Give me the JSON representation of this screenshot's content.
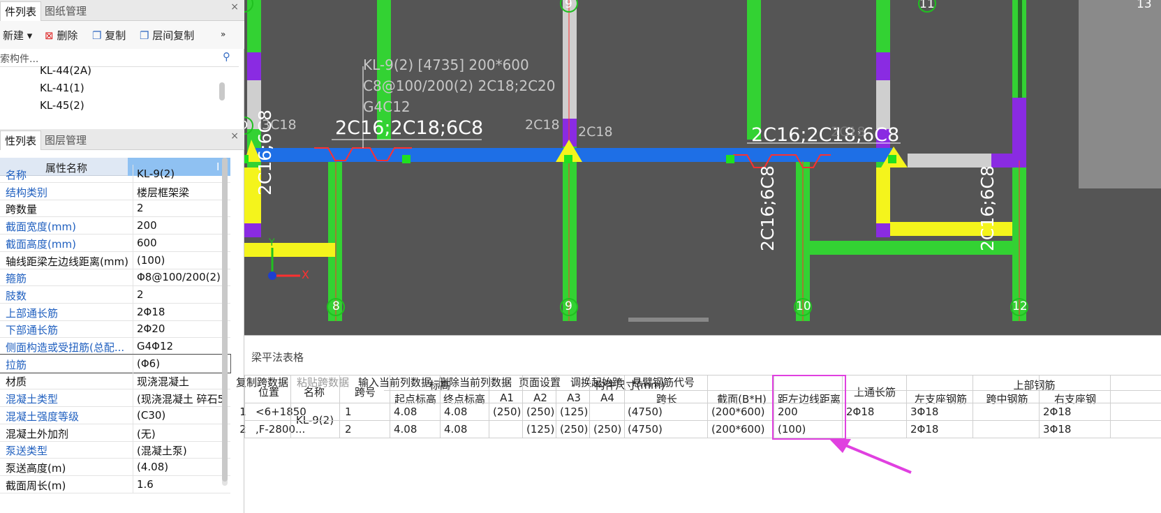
{
  "component_list": {
    "tabs": [
      "件列表",
      "图纸管理"
    ],
    "toolbar": {
      "new": "新建",
      "delete": "删除",
      "copy": "复制",
      "floor_copy": "层间复制",
      "more": "»"
    },
    "search_placeholder": "索构件...",
    "items": [
      "KL-44(2A)",
      "KL-41(1)",
      "KL-45(2)"
    ]
  },
  "property_list": {
    "tabs": [
      "性列表",
      "图层管理"
    ],
    "header_name": "属性名称",
    "header_value": "I",
    "rows": [
      {
        "name": "名称",
        "value": "KL-9(2)",
        "blue": true
      },
      {
        "name": "结构类别",
        "value": "楼层框架梁",
        "blue": true
      },
      {
        "name": "跨数量",
        "value": "2",
        "blue": false
      },
      {
        "name": "截面宽度(mm)",
        "value": "200",
        "blue": true
      },
      {
        "name": "截面高度(mm)",
        "value": "600",
        "blue": true
      },
      {
        "name": "轴线距梁左边线距离(mm)",
        "value": "(100)",
        "blue": false
      },
      {
        "name": "箍筋",
        "value": "Φ8@100/200(2)",
        "blue": true
      },
      {
        "name": "肢数",
        "value": "2",
        "blue": true
      },
      {
        "name": "上部通长筋",
        "value": "2Φ18",
        "blue": true
      },
      {
        "name": "下部通长筋",
        "value": "2Φ20",
        "blue": true
      },
      {
        "name": "侧面构造或受扭筋(总配...",
        "value": "G4Φ12",
        "blue": true
      },
      {
        "name": "拉筋",
        "value": "(Φ6)",
        "blue": true
      },
      {
        "name": "材质",
        "value": "现浇混凝土",
        "blue": false
      },
      {
        "name": "混凝土类型",
        "value": "(现浇混凝土   碎石5",
        "blue": true
      },
      {
        "name": "混凝土强度等级",
        "value": "(C30)",
        "blue": true
      },
      {
        "name": "混凝土外加剂",
        "value": "(无)",
        "blue": false
      },
      {
        "name": "泵送类型",
        "value": "(混凝土泵)",
        "blue": true
      },
      {
        "name": "泵送高度(m)",
        "value": "(4.08)",
        "blue": false
      },
      {
        "name": "截面周长(m)",
        "value": "1.6",
        "blue": false
      }
    ]
  },
  "canvas": {
    "axis_labels_top": [
      "E",
      "9",
      "11",
      "13"
    ],
    "axis_labels_bottom": [
      "8",
      "9",
      "10",
      "12"
    ],
    "axis_label_d": "D",
    "beam_annotation": [
      "KL-9(2) [4735] 200*600",
      "C8@100/200(2) 2C18;2C20",
      "G4C12"
    ],
    "rebar_top_labels": [
      "2C16;2C18;6C8",
      "2C16;2C18;6C8"
    ],
    "rebar_small": [
      "3C18",
      "2C18",
      "2C18",
      "2C18"
    ],
    "rebar_vertical": [
      "2C16;6C8",
      "2C16;6C8",
      "2C16;6C8"
    ],
    "axis_x": "X",
    "axis_y": "Y"
  },
  "beam_table": {
    "title": "梁平法表格",
    "toolbar": [
      "复制跨数据",
      "粘贴跨数据",
      "输入当前列数据",
      "删除当前列数据",
      "页面设置",
      "调换起始跨",
      "悬臂钢筋代号"
    ],
    "headers": {
      "position": "位置",
      "name": "名称",
      "span": "跨号",
      "elevation": "标高",
      "start_elev": "起点标高",
      "end_elev": "终点标高",
      "dims": "构件尺寸(mm)",
      "a1": "A1",
      "a2": "A2",
      "a3": "A3",
      "a4": "A4",
      "span_len": "跨长",
      "section": "截面(B*H)",
      "left_dist": "距左边线距离",
      "top_through": "上通长筋",
      "top_rebar": "上部钢筋",
      "left_support": "左支座钢筋",
      "mid_span": "跨中钢筋",
      "right_support": "右支座钢"
    },
    "rows": [
      {
        "idx": "1",
        "position": "<6+1850",
        "name": "KL-9(2)",
        "span": "1",
        "start": "4.08",
        "end": "4.08",
        "a1": "(250)",
        "a2": "(250)",
        "a3": "(125)",
        "a4": "",
        "len": "(4750)",
        "section": "(200*600)",
        "left": "200",
        "through": "2Φ18",
        "lsup": "3Φ18",
        "mid": "",
        "rsup": "2Φ18"
      },
      {
        "idx": "2",
        "position": ",F-2800...",
        "name": "",
        "span": "2",
        "start": "4.08",
        "end": "4.08",
        "a1": "",
        "a2": "(125)",
        "a3": "(250)",
        "a4": "(250)",
        "len": "(4750)",
        "section": "(200*600)",
        "left": "(100)",
        "through": "",
        "lsup": "2Φ18",
        "mid": "",
        "rsup": "3Φ18"
      }
    ]
  },
  "colors": {
    "highlight": "#e040e0",
    "beam_blue": "#1e6fe6",
    "column_green": "#33d233",
    "purple": "#8a2be2",
    "yellow": "#f4f41c"
  }
}
